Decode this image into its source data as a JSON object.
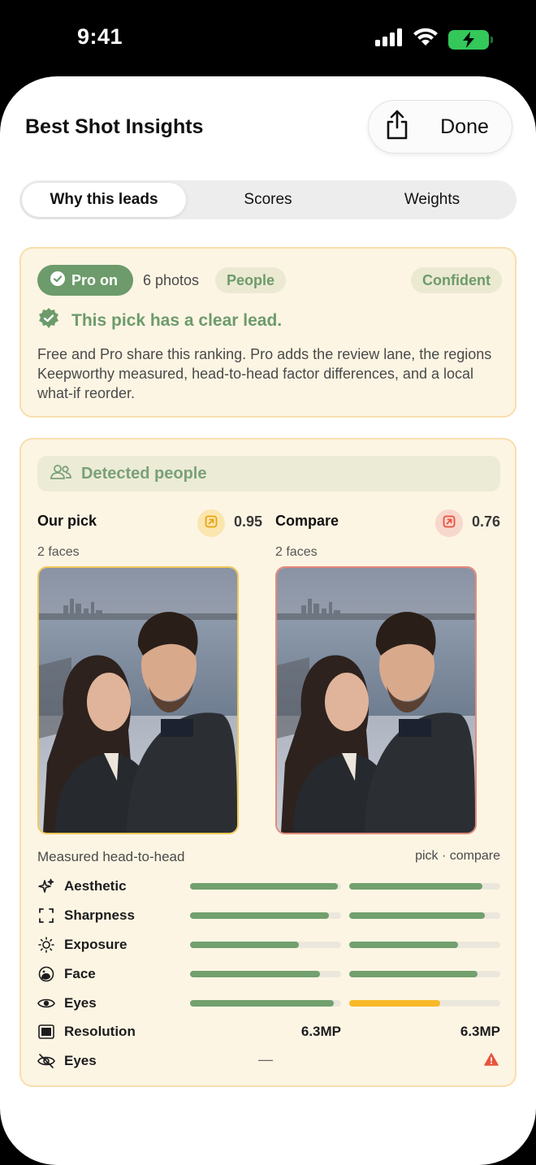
{
  "status_bar": {
    "time": "9:41"
  },
  "header": {
    "title": "Best Shot Insights",
    "done_label": "Done"
  },
  "tabs": [
    {
      "label": "Why this leads",
      "active": true
    },
    {
      "label": "Scores",
      "active": false
    },
    {
      "label": "Weights",
      "active": false
    }
  ],
  "summary": {
    "pro_label": "Pro on",
    "photos_label": "6 photos",
    "category_label": "People",
    "confidence_label": "Confident",
    "lead_text": "This pick has a clear lead.",
    "body_text": "Free and Pro share this ranking. Pro adds the review lane, the regions Keepworthy measured, head-to-head factor differences, and a local what-if reorder."
  },
  "detected": {
    "banner_label": "Detected people",
    "pick": {
      "title": "Our pick",
      "score": "0.95",
      "faces": "2 faces"
    },
    "compare": {
      "title": "Compare",
      "score": "0.76",
      "faces": "2 faces"
    }
  },
  "head_to_head": {
    "label": "Measured head-to-head",
    "legend": "pick · compare",
    "metrics": [
      {
        "name": "Aesthetic",
        "icon": "sparkles-icon",
        "pick": 0.98,
        "compare": 0.88
      },
      {
        "name": "Sharpness",
        "icon": "focus-frame-icon",
        "pick": 0.92,
        "compare": 0.9
      },
      {
        "name": "Exposure",
        "icon": "sun-icon",
        "pick": 0.72,
        "compare": 0.72
      },
      {
        "name": "Face",
        "icon": "face-icon",
        "pick": 0.86,
        "compare": 0.85
      },
      {
        "name": "Eyes",
        "icon": "eye-icon",
        "pick": 0.95,
        "compare": 0.6
      }
    ],
    "resolution": {
      "name": "Resolution",
      "icon": "display-icon",
      "pick": "6.3MP",
      "compare": "6.3MP"
    },
    "eyes_closed": {
      "name": "Eyes",
      "icon": "eye-slash-icon",
      "pick": "—",
      "compare_icon": "warning-icon"
    }
  },
  "colors": {
    "accent_green": "#6d9b6c",
    "bar_green": "#72a06e",
    "bar_warning": "#f7b928",
    "warning_red": "#e8533f",
    "card_bg": "#fdf5e3",
    "card_border": "#f7dfae"
  }
}
